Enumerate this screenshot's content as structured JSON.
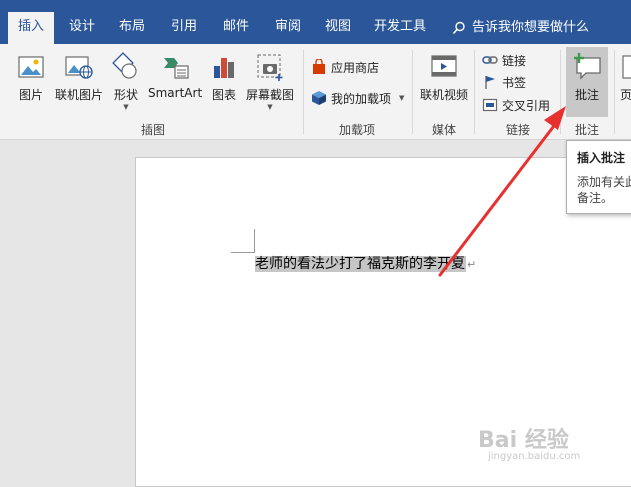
{
  "tabs": [
    {
      "label": "插入",
      "active": true
    },
    {
      "label": "设计"
    },
    {
      "label": "布局"
    },
    {
      "label": "引用"
    },
    {
      "label": "邮件"
    },
    {
      "label": "审阅"
    },
    {
      "label": "视图"
    },
    {
      "label": "开发工具"
    }
  ],
  "tellme": "告诉我你想要做什么",
  "ribbon": {
    "illustrations": {
      "picture": "图片",
      "online_picture": "联机图片",
      "shapes": "形状",
      "smartart": "SmartArt",
      "chart": "图表",
      "screenshot": "屏幕截图",
      "group_label": "插图"
    },
    "addins": {
      "store": "应用商店",
      "my_addins": "我的加载项",
      "group_label": "加载项"
    },
    "media": {
      "online_video": "联机视频",
      "group_label": "媒体"
    },
    "links": {
      "link": "链接",
      "bookmark": "书签",
      "cross_ref": "交叉引用",
      "group_label": "链接"
    },
    "comments": {
      "comment": "批注",
      "group_label": "批注"
    },
    "partial": "页"
  },
  "tooltip": {
    "title": "插入批注",
    "desc_line1": "添加有关此",
    "desc_line2": "备注。"
  },
  "document": {
    "text": "老师的看法少打了福克斯的李开夏",
    "para_mark": "↵"
  },
  "watermark": {
    "brand": "Bai 经验",
    "url": "jingyan.baidu.com"
  },
  "colors": {
    "ribbon_blue": "#2b579a",
    "annotation_arrow": "#e8312f"
  }
}
